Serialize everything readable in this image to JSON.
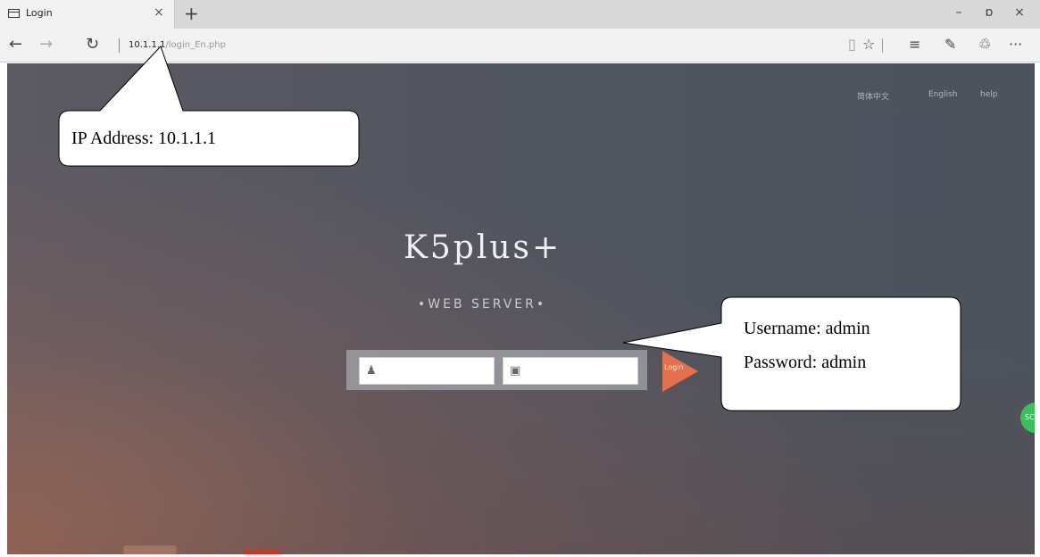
{
  "browser": {
    "tab_title": "Login",
    "tab_close": "×",
    "new_tab": "+",
    "window_controls": {
      "minimize": "–",
      "restore": "ɒ",
      "close": "×"
    },
    "nav": {
      "back": "←",
      "forward": "→",
      "refresh": "↻"
    },
    "url_host": "10.1.1.1",
    "url_path": "/login_En.php",
    "toolbar": {
      "reading_view": "▯",
      "favorite": "☆",
      "hub": "≡",
      "notes": "✎",
      "share": "♲",
      "more": "···"
    }
  },
  "page": {
    "languages": [
      "简体中文",
      "English",
      "help"
    ],
    "logo": "K5plus+",
    "subtitle": "•WEB SERVER•",
    "username_icon": "user-icon",
    "password_icon": "lock-icon",
    "login_button": "Login",
    "chat_badge": "SC"
  },
  "callouts": {
    "ip_address": "IP Address: 10.1.1.1",
    "username": "Username: admin",
    "password": "Password: admin"
  },
  "colors": {
    "login_accent": "#e4704c",
    "background": "#50545f",
    "chat_badge": "#3cbf5a"
  }
}
